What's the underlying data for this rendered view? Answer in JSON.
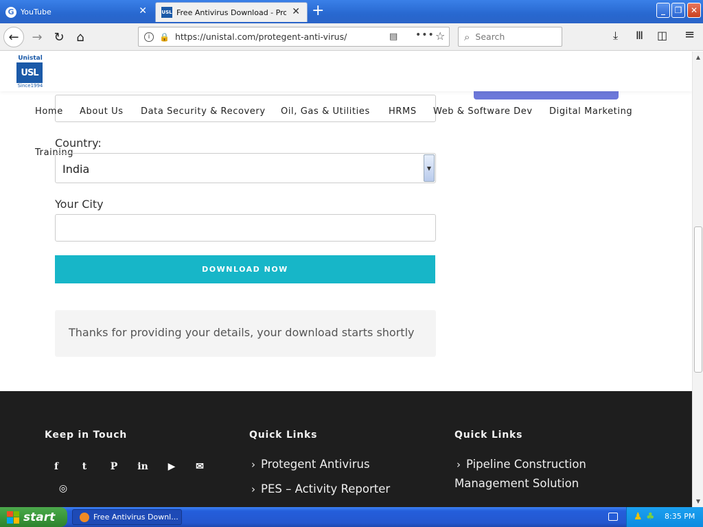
{
  "browser": {
    "tabs": [
      {
        "title": "YouTube",
        "active": false
      },
      {
        "title": "Free Antivirus Download - Protege",
        "active": true
      }
    ],
    "url": "https://unistal.com/protegent-anti-virus/",
    "search_placeholder": "Search"
  },
  "site": {
    "logo": {
      "top": "Unistal",
      "mark": "USL",
      "since": "Since1994"
    },
    "menu": [
      "Home",
      "About Us",
      "Data Security & Recovery",
      "Oil, Gas & Utilities",
      "HRMS",
      "Web & Software Dev",
      "Digital Marketing",
      "Training"
    ]
  },
  "form": {
    "country_label": "Country:",
    "country_value": "India",
    "city_label": "Your City",
    "city_value": "",
    "download_button": "DOWNLOAD NOW",
    "thanks_message": "Thanks for providing your details, your download starts shortly"
  },
  "footer": {
    "keep_in_touch": "Keep in Touch",
    "social_icons": [
      "facebook-icon",
      "twitter-icon",
      "pinterest-icon",
      "linkedin-icon",
      "youtube-icon",
      "email-icon",
      "instagram-icon"
    ],
    "quick_links_1": {
      "title": "Quick Links",
      "items": [
        "Protegent Antivirus",
        "PES – Activity Reporter"
      ]
    },
    "quick_links_2": {
      "title": "Quick Links",
      "items": [
        "Pipeline Construction",
        "Management Solution"
      ]
    }
  },
  "taskbar": {
    "start_label": "start",
    "task_item": "Free Antivirus Downl...",
    "clock": "8:35 PM"
  },
  "colors": {
    "accent_teal": "#17b6c8",
    "footer_bg": "#1e1e1e",
    "brand_blue": "#1b5aa8"
  }
}
